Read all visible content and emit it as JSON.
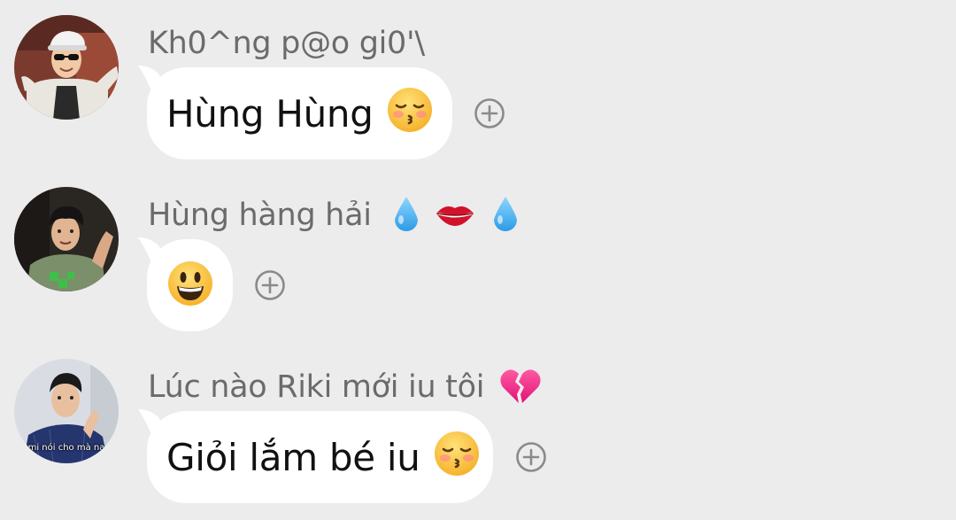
{
  "messages": [
    {
      "sender": "Kh0^ng p@o gi0'\\",
      "text": "Hùng Hùng",
      "text_emoji": "kissing-face-closed-eyes",
      "avatar": "avatar-sunglasses-cap"
    },
    {
      "sender": "Hùng hàng hải",
      "sender_emojis": [
        "droplet",
        "lips",
        "droplet"
      ],
      "text": "",
      "text_emoji": "grinning-face",
      "avatar": "avatar-green-shirt"
    },
    {
      "sender": "Lúc nào Riki mới iu tôi",
      "sender_emojis": [
        "broken-heart"
      ],
      "text": "Giỏi lắm bé iu",
      "text_emoji": "kissing-face-closed-eyes",
      "avatar": "avatar-video-caption",
      "avatar_caption": "mi nói cho mà nạ"
    }
  ],
  "colors": {
    "background": "#ececec",
    "bubble": "#ffffff",
    "sender_text": "#6b6b6b",
    "message_text": "#111111",
    "react_icon": "#8a8a8a"
  },
  "icons": {
    "react_button": "add-reaction-plus-icon"
  }
}
